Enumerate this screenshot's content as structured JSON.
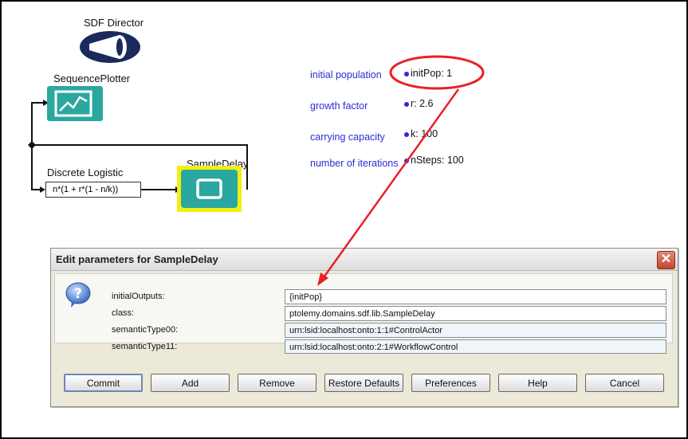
{
  "canvas": {
    "director_label": "SDF Director",
    "plotter_label": "SequencePlotter",
    "logistic_label": "Discrete Logistic",
    "logistic_expression": "n*(1 + r*(1 - n/k))",
    "sampledelay_label": "SampleDelay",
    "parameters": [
      {
        "label": "initial population",
        "value": "initPop: 1"
      },
      {
        "label": "growth factor",
        "value": "r: 2.6"
      },
      {
        "label": "carrying capacity",
        "value": "k: 100"
      },
      {
        "label": "number of iterations",
        "value": "nSteps: 100"
      }
    ]
  },
  "dialog": {
    "title": "Edit parameters for SampleDelay",
    "fields": [
      {
        "label": "initialOutputs:",
        "value": "{initPop}"
      },
      {
        "label": "class:",
        "value": "ptolemy.domains.sdf.lib.SampleDelay"
      },
      {
        "label": "semanticType00:",
        "value": "urn:lsid:localhost:onto:1:1#ControlActor"
      },
      {
        "label": "semanticType11:",
        "value": "urn:lsid:localhost:onto:2:1#WorkflowControl"
      }
    ],
    "buttons": {
      "commit": "Commit",
      "add": "Add",
      "remove": "Remove",
      "restore_defaults": "Restore Defaults",
      "preferences": "Preferences",
      "help": "Help",
      "cancel": "Cancel"
    }
  },
  "colors": {
    "actor_teal": "#2aa7a0",
    "highlight_yellow": "#f2ef12",
    "annotation_red": "#e8202a",
    "param_blue": "#2b2bd6"
  },
  "icons": {
    "director": "director-megaphone-icon",
    "plotter": "plotter-icon",
    "sampledelay": "sampledelay-icon",
    "help": "question-icon",
    "close": "close-icon"
  }
}
